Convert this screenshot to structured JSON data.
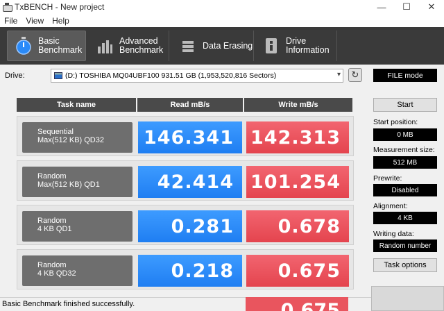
{
  "window": {
    "title": "TxBENCH - New project",
    "controls": [
      "—",
      "☐",
      "✕"
    ]
  },
  "menu": [
    "File",
    "View",
    "Help"
  ],
  "tabs": [
    {
      "label": "Basic\nBenchmark",
      "icon": "stopwatch-icon",
      "active": true
    },
    {
      "label": "Advanced\nBenchmark",
      "icon": "bar-chart-icon",
      "active": false
    },
    {
      "label": "Data Erasing",
      "icon": "eraser-icon",
      "active": false
    },
    {
      "label": "Drive\nInformation",
      "icon": "drive-info-icon",
      "active": false
    }
  ],
  "drive": {
    "label": "Drive:",
    "selected": "(D:) TOSHIBA MQ04UBF100  931.51 GB (1,953,520,816 Sectors)",
    "mode": "FILE mode"
  },
  "table": {
    "headers": [
      "Task name",
      "Read mB/s",
      "Write mB/s"
    ],
    "rows": [
      {
        "task": "Sequential\nMax(512 KB) QD32",
        "read": "146.341",
        "write": "142.313"
      },
      {
        "task": "Random\nMax(512 KB) QD1",
        "read": "42.414",
        "write": "101.254"
      },
      {
        "task": "Random\n4 KB QD1",
        "read": "0.281",
        "write": "0.678"
      },
      {
        "task": "Random\n4 KB QD32",
        "read": "0.218",
        "write": "0.675"
      }
    ],
    "peek_value": "0.675"
  },
  "side": {
    "start": "Start",
    "start_position_label": "Start position:",
    "start_position": "0 MB",
    "measurement_size_label": "Measurement size:",
    "measurement_size": "512 MB",
    "prewrite_label": "Prewrite:",
    "prewrite": "Disabled",
    "alignment_label": "Alignment:",
    "alignment": "4 KB",
    "writing_data_label": "Writing data:",
    "writing_data": "Random number",
    "task_options": "Task options"
  },
  "status": "Basic Benchmark finished successfully.",
  "colors": {
    "read": "#2a8af8",
    "write": "#ea4d57",
    "toolbar": "#3a3a3a"
  }
}
